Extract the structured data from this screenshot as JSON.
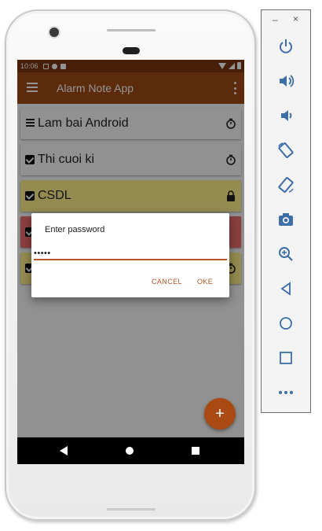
{
  "statusbar": {
    "time": "10:06"
  },
  "appbar": {
    "title": "Alarm Note App"
  },
  "notes": [
    {
      "title": "Lam bai Android",
      "lead": "lines-icon",
      "trail": "timer-icon",
      "color": "#fafafa"
    },
    {
      "title": "Thi cuoi ki",
      "lead": "checkbox-icon",
      "trail": "timer-icon",
      "color": "#fafafa"
    },
    {
      "title": "CSDL",
      "lead": "checkbox-icon",
      "trail": "lock-icon",
      "color": "#fdf08a"
    },
    {
      "title": "",
      "lead": "checkbox-icon",
      "trail": "",
      "color": "#f06d6d"
    },
    {
      "title": "",
      "lead": "checkbox-icon",
      "trail": "timer-icon",
      "color": "#fdf08a"
    }
  ],
  "dialog": {
    "title": "Enter password",
    "value": "•••••",
    "cancel_label": "CANCEL",
    "ok_label": "OKE"
  },
  "fab": {
    "label": "+"
  },
  "toolbar": {
    "minimize": "–",
    "close": "×"
  },
  "colors": {
    "accent": "#9e4a14",
    "status": "#7b3610"
  }
}
